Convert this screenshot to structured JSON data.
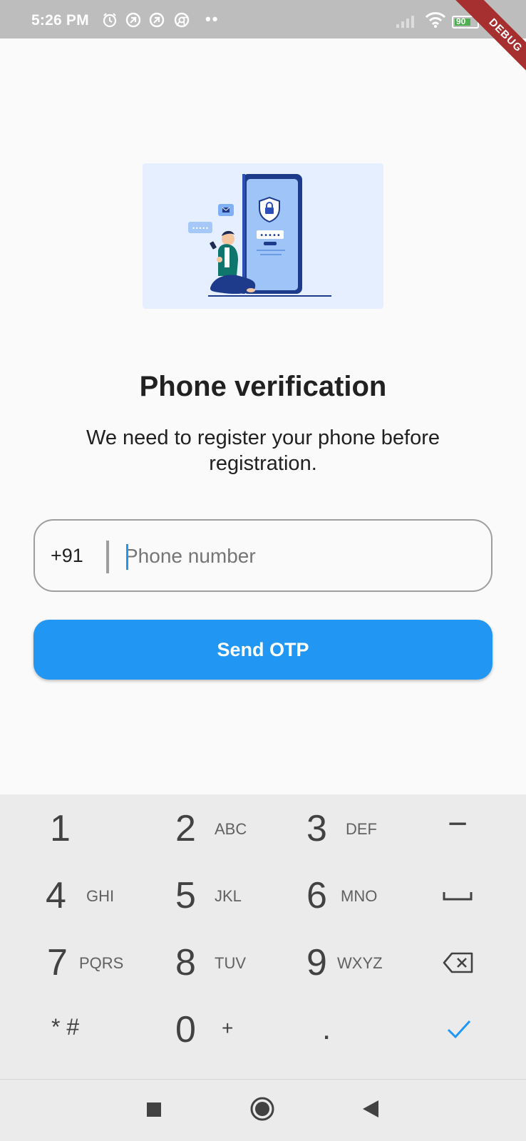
{
  "status_bar": {
    "time": "5:26 PM",
    "icons": [
      "alarm-icon",
      "notification-icon",
      "notification-icon",
      "chrome-icon",
      "more-dots-icon"
    ],
    "battery": "90"
  },
  "debug_banner": "DEBUG",
  "main": {
    "title": "Phone verification",
    "subtitle": "We need to register your phone before registration.",
    "country_code": "+91",
    "phone_placeholder": "Phone number",
    "phone_value": "",
    "send_button": "Send OTP"
  },
  "illustration": {
    "password_dots": "•••••",
    "bubble_dots": "•••••"
  },
  "keyboard": {
    "keys": [
      {
        "num": "1",
        "letters": ""
      },
      {
        "num": "2",
        "letters": "ABC"
      },
      {
        "num": "3",
        "letters": "DEF"
      },
      {
        "num": "−",
        "letters": ""
      },
      {
        "num": "4",
        "letters": "GHI"
      },
      {
        "num": "5",
        "letters": "JKL"
      },
      {
        "num": "6",
        "letters": "MNO"
      },
      {
        "num": "space",
        "letters": ""
      },
      {
        "num": "7",
        "letters": "PQRS"
      },
      {
        "num": "8",
        "letters": "TUV"
      },
      {
        "num": "9",
        "letters": "WXYZ"
      },
      {
        "num": "backspace",
        "letters": ""
      },
      {
        "num": "* #",
        "letters": ""
      },
      {
        "num": "0",
        "letters": "+"
      },
      {
        "num": ".",
        "letters": ""
      },
      {
        "num": "done",
        "letters": ""
      }
    ]
  },
  "colors": {
    "primary": "#2196f3",
    "status_bar": "#bdbdbd",
    "banner": "#a62f2f",
    "illustration_bg": "#e5efff"
  }
}
